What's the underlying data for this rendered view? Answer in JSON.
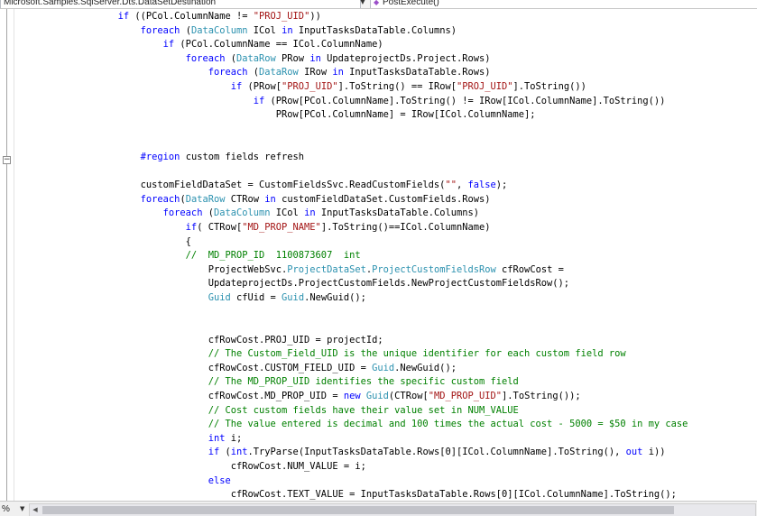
{
  "navigation": {
    "class_dropdown": "Microsoft.Samples.SqlServer.Dts.DataSetDestination",
    "member_dropdown": "PostExecute()",
    "member_icon": "method-icon"
  },
  "status": {
    "zoom_label": "%"
  },
  "code_lines": [
    [
      {
        "t": "                  "
      },
      {
        "t": "if",
        "c": "kw"
      },
      {
        "t": " ((PCol.ColumnName != "
      },
      {
        "t": "\"PROJ_UID\"",
        "c": "st"
      },
      {
        "t": "))"
      }
    ],
    [
      {
        "t": "                      "
      },
      {
        "t": "foreach",
        "c": "kw"
      },
      {
        "t": " ("
      },
      {
        "t": "DataColumn",
        "c": "tp"
      },
      {
        "t": " ICol "
      },
      {
        "t": "in",
        "c": "kw"
      },
      {
        "t": " InputTasksDataTable.Columns)"
      }
    ],
    [
      {
        "t": "                          "
      },
      {
        "t": "if",
        "c": "kw"
      },
      {
        "t": " (PCol.ColumnName == ICol.ColumnName)"
      }
    ],
    [
      {
        "t": "                              "
      },
      {
        "t": "foreach",
        "c": "kw"
      },
      {
        "t": " ("
      },
      {
        "t": "DataRow",
        "c": "tp"
      },
      {
        "t": " PRow "
      },
      {
        "t": "in",
        "c": "kw"
      },
      {
        "t": " UpdateprojectDs.Project.Rows)"
      }
    ],
    [
      {
        "t": "                                  "
      },
      {
        "t": "foreach",
        "c": "kw"
      },
      {
        "t": " ("
      },
      {
        "t": "DataRow",
        "c": "tp"
      },
      {
        "t": " IRow "
      },
      {
        "t": "in",
        "c": "kw"
      },
      {
        "t": " InputTasksDataTable.Rows)"
      }
    ],
    [
      {
        "t": "                                      "
      },
      {
        "t": "if",
        "c": "kw"
      },
      {
        "t": " (PRow["
      },
      {
        "t": "\"PROJ_UID\"",
        "c": "st"
      },
      {
        "t": "].ToString() == IRow["
      },
      {
        "t": "\"PROJ_UID\"",
        "c": "st"
      },
      {
        "t": "].ToString())"
      }
    ],
    [
      {
        "t": "                                          "
      },
      {
        "t": "if",
        "c": "kw"
      },
      {
        "t": " (PRow[PCol.ColumnName].ToString() != IRow[ICol.ColumnName].ToString())"
      }
    ],
    [
      {
        "t": "                                              PRow[PCol.ColumnName] = IRow[ICol.ColumnName];"
      }
    ],
    [
      {
        "t": ""
      }
    ],
    [
      {
        "t": ""
      }
    ],
    [
      {
        "t": "                      "
      },
      {
        "t": "#region",
        "c": "kw"
      },
      {
        "t": " custom fields refresh"
      }
    ],
    [
      {
        "t": ""
      }
    ],
    [
      {
        "t": "                      customFieldDataSet = CustomFieldsSvc.ReadCustomFields("
      },
      {
        "t": "\"\"",
        "c": "st"
      },
      {
        "t": ", "
      },
      {
        "t": "false",
        "c": "kw"
      },
      {
        "t": ");"
      }
    ],
    [
      {
        "t": "                      "
      },
      {
        "t": "foreach",
        "c": "kw"
      },
      {
        "t": "("
      },
      {
        "t": "DataRow",
        "c": "tp"
      },
      {
        "t": " CTRow "
      },
      {
        "t": "in",
        "c": "kw"
      },
      {
        "t": " customFieldDataSet.CustomFields.Rows)"
      }
    ],
    [
      {
        "t": "                          "
      },
      {
        "t": "foreach",
        "c": "kw"
      },
      {
        "t": " ("
      },
      {
        "t": "DataColumn",
        "c": "tp"
      },
      {
        "t": " ICol "
      },
      {
        "t": "in",
        "c": "kw"
      },
      {
        "t": " InputTasksDataTable.Columns)"
      }
    ],
    [
      {
        "t": "                              "
      },
      {
        "t": "if",
        "c": "kw"
      },
      {
        "t": "( CTRow["
      },
      {
        "t": "\"MD_PROP_NAME\"",
        "c": "st"
      },
      {
        "t": "].ToString()==ICol.ColumnName)"
      }
    ],
    [
      {
        "t": "                              {"
      }
    ],
    [
      {
        "t": "                              "
      },
      {
        "t": "//  MD_PROP_ID  1100873607  int",
        "c": "cm"
      }
    ],
    [
      {
        "t": "                                  ProjectWebSvc."
      },
      {
        "t": "ProjectDataSet",
        "c": "tp"
      },
      {
        "t": "."
      },
      {
        "t": "ProjectCustomFieldsRow",
        "c": "tp"
      },
      {
        "t": " cfRowCost ="
      }
    ],
    [
      {
        "t": "                                  UpdateprojectDs.ProjectCustomFields.NewProjectCustomFieldsRow();"
      }
    ],
    [
      {
        "t": "                                  "
      },
      {
        "t": "Guid",
        "c": "tp"
      },
      {
        "t": " cfUid = "
      },
      {
        "t": "Guid",
        "c": "tp"
      },
      {
        "t": ".NewGuid();"
      }
    ],
    [
      {
        "t": ""
      }
    ],
    [
      {
        "t": ""
      }
    ],
    [
      {
        "t": "                                  cfRowCost.PROJ_UID = projectId;"
      }
    ],
    [
      {
        "t": "                                  "
      },
      {
        "t": "// The Custom_Field_UID is the unique identifier for each custom field row",
        "c": "cm"
      }
    ],
    [
      {
        "t": "                                  cfRowCost.CUSTOM_FIELD_UID = "
      },
      {
        "t": "Guid",
        "c": "tp"
      },
      {
        "t": ".NewGuid();"
      }
    ],
    [
      {
        "t": "                                  "
      },
      {
        "t": "// The MD_PROP_UID identifies the specific custom field",
        "c": "cm"
      }
    ],
    [
      {
        "t": "                                  cfRowCost.MD_PROP_UID = "
      },
      {
        "t": "new",
        "c": "kw"
      },
      {
        "t": " "
      },
      {
        "t": "Guid",
        "c": "tp"
      },
      {
        "t": "(CTRow["
      },
      {
        "t": "\"MD_PROP_UID\"",
        "c": "st"
      },
      {
        "t": "].ToString());"
      }
    ],
    [
      {
        "t": "                                  "
      },
      {
        "t": "// Cost custom fields have their value set in NUM_VALUE",
        "c": "cm"
      }
    ],
    [
      {
        "t": "                                  "
      },
      {
        "t": "// The value entered is decimal and 100 times the actual cost - 5000 = $50 in my case",
        "c": "cm"
      }
    ],
    [
      {
        "t": "                                  "
      },
      {
        "t": "int",
        "c": "kw"
      },
      {
        "t": " i;"
      }
    ],
    [
      {
        "t": "                                  "
      },
      {
        "t": "if",
        "c": "kw"
      },
      {
        "t": " ("
      },
      {
        "t": "int",
        "c": "kw"
      },
      {
        "t": ".TryParse(InputTasksDataTable.Rows[0][ICol.ColumnName].ToString(), "
      },
      {
        "t": "out",
        "c": "kw"
      },
      {
        "t": " i))"
      }
    ],
    [
      {
        "t": "                                      cfRowCost.NUM_VALUE = i;"
      }
    ],
    [
      {
        "t": "                                  "
      },
      {
        "t": "else",
        "c": "kw"
      }
    ],
    [
      {
        "t": "                                      cfRowCost.TEXT_VALUE = InputTasksDataTable.Rows[0][ICol.ColumnName].ToString();"
      }
    ]
  ]
}
